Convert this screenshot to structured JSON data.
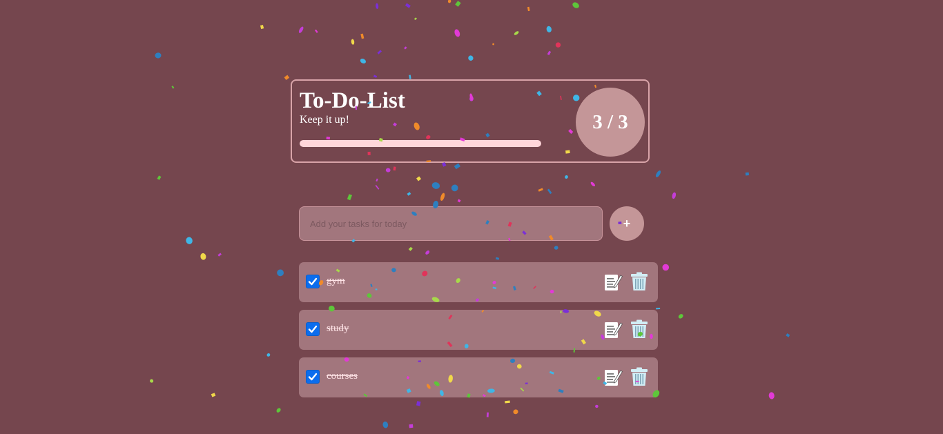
{
  "header": {
    "title": "To-Do-List",
    "subtitle": "Keep it up!",
    "progress_fraction": 1.0,
    "counter_text": "3 / 3"
  },
  "new_task": {
    "placeholder": "Add your tasks for today",
    "value": "",
    "add_label": "+"
  },
  "tasks": [
    {
      "text": "gym",
      "completed": true
    },
    {
      "text": "study",
      "completed": true
    },
    {
      "text": "courses",
      "completed": true
    }
  ],
  "icons": {
    "add": "plus-icon",
    "edit": "edit-icon",
    "delete": "trash-icon",
    "check": "checkmark-icon"
  },
  "colors": {
    "background": "#75464e",
    "card_border": "#d9a4a9",
    "accent_circle": "#c49698",
    "progress_fill": "#ffd6da",
    "task_bg": "#a2767d",
    "checkbox": "#0b6dee"
  }
}
